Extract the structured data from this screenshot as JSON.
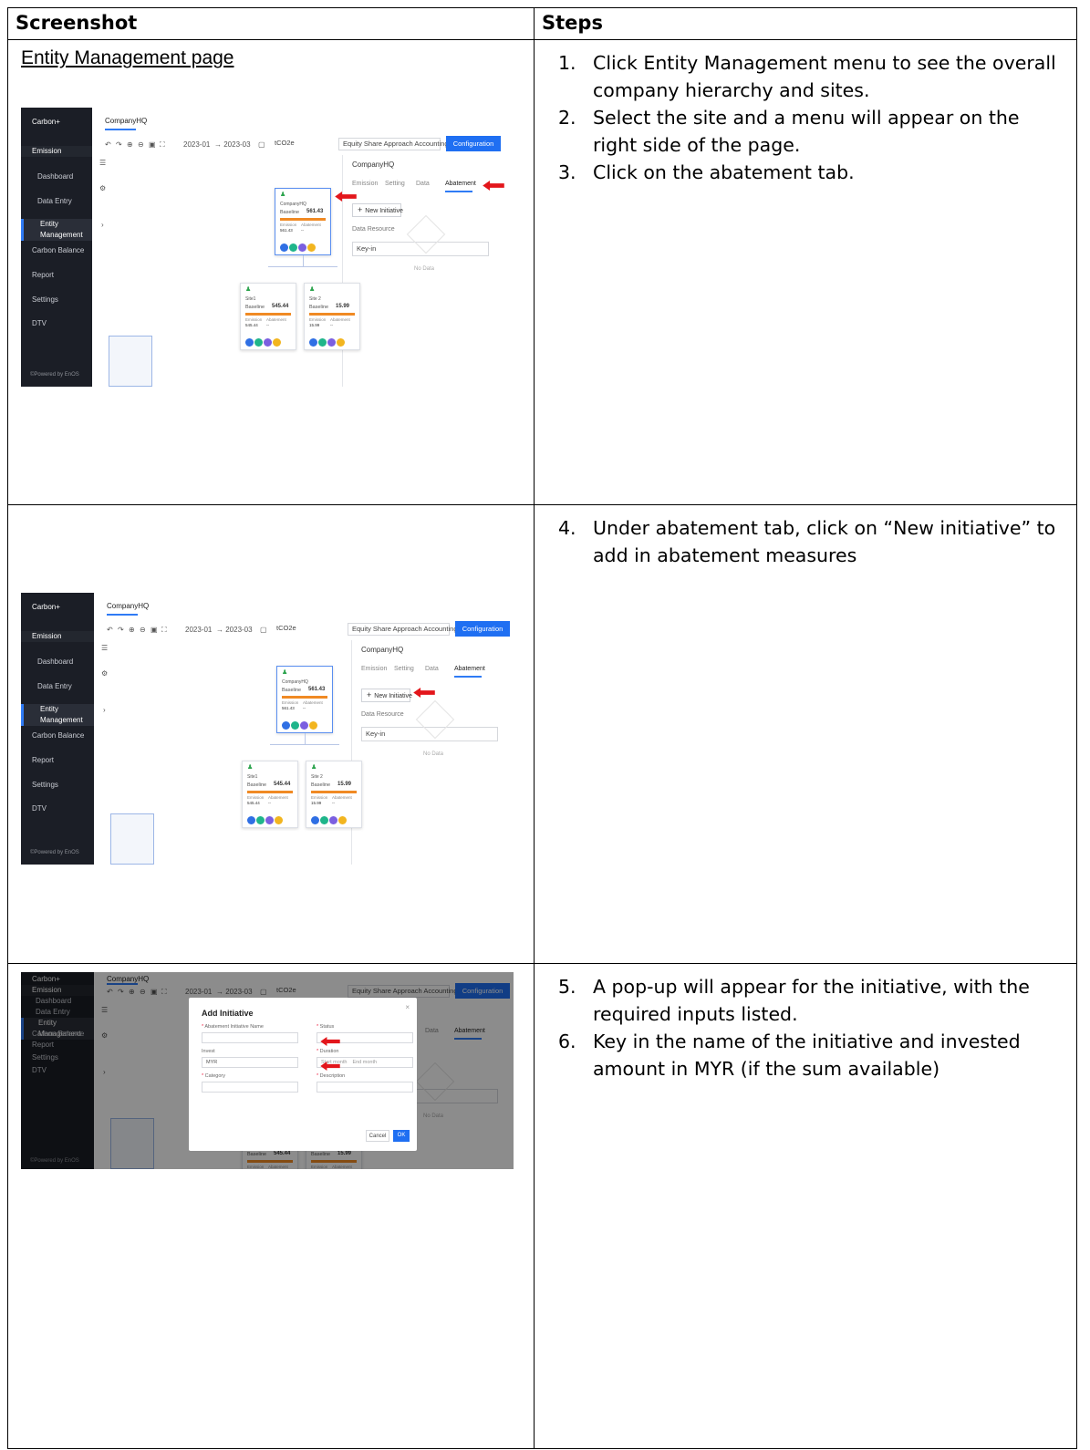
{
  "table": {
    "headers": [
      "Screenshot",
      "Steps"
    ],
    "rows": [
      {
        "caption": "Entity Management page",
        "steps": [
          {
            "num": "1.",
            "text": "Click Entity Management menu to see the overall company hierarchy and sites."
          },
          {
            "num": "2.",
            "text": "Select the site and a menu will appear on the right side of the page."
          },
          {
            "num": "3.",
            "text": "Click on the abatement tab."
          }
        ]
      },
      {
        "caption": "",
        "steps": [
          {
            "num": "4.",
            "text": "Under abatement tab, click on “New initiative” to add in abatement measures"
          }
        ]
      },
      {
        "caption": "",
        "steps": [
          {
            "num": "5.",
            "text": "A pop-up will appear for the initiative, with the required inputs listed."
          },
          {
            "num": "6.",
            "text": "Key in the name of the initiative and invested amount in MYR (if the sum available)"
          }
        ]
      }
    ]
  },
  "app": {
    "brand": "Carbon+",
    "menu": [
      "Emission",
      "Dashboard",
      "Data Entry",
      "Entity Management",
      "Carbon Balance",
      "Report",
      "Settings",
      "DTV"
    ],
    "footer": "©Powered by EnOS",
    "page_tab": "CompanyHQ",
    "date_from": "2023-01",
    "date_to": "→ 2023-03",
    "unit": "tCO2e",
    "approach": "Equity Share Approach Accounting",
    "config_button": "Configuration",
    "panel_title": "CompanyHQ",
    "panel_tabs": [
      "Emission",
      "Setting",
      "Data",
      "Abatement"
    ],
    "new_initiative": "New Initiative",
    "data_resource": "Data Resource",
    "key_in": "Key-in",
    "no_data": "No Data",
    "nodes": [
      {
        "name": "CompanyHQ",
        "baseline_label": "Baseline",
        "baseline": "561.43",
        "emission_label": "Emission",
        "abatement_label": "Abatement",
        "emission": "561.43",
        "abatement": "--"
      },
      {
        "name": "Site1",
        "baseline_label": "Baseline",
        "baseline": "545.44",
        "emission_label": "Emission",
        "abatement_label": "Abatement",
        "emission": "545.44",
        "abatement": "--"
      },
      {
        "name": "Site 2",
        "baseline_label": "Baseline",
        "baseline": "15.99",
        "emission_label": "Emission",
        "abatement_label": "Abatement",
        "emission": "15.99",
        "abatement": "--"
      }
    ],
    "dot_colors": [
      "#2f6fe4",
      "#1fb58a",
      "#7b5fe0",
      "#f2b51f"
    ],
    "arrow_color": "#e3161b"
  },
  "modal": {
    "title": "Add Initiative",
    "name_label": "Abatement Initiative Name",
    "status_label": "Status",
    "invest_label": "Invest",
    "invest_prefix": "MYR",
    "duration_label": "Duration",
    "start_placeholder": "Start month",
    "end_placeholder": "End month",
    "category_label": "Category",
    "description_label": "Description",
    "cancel": "Cancel",
    "ok": "OK"
  }
}
